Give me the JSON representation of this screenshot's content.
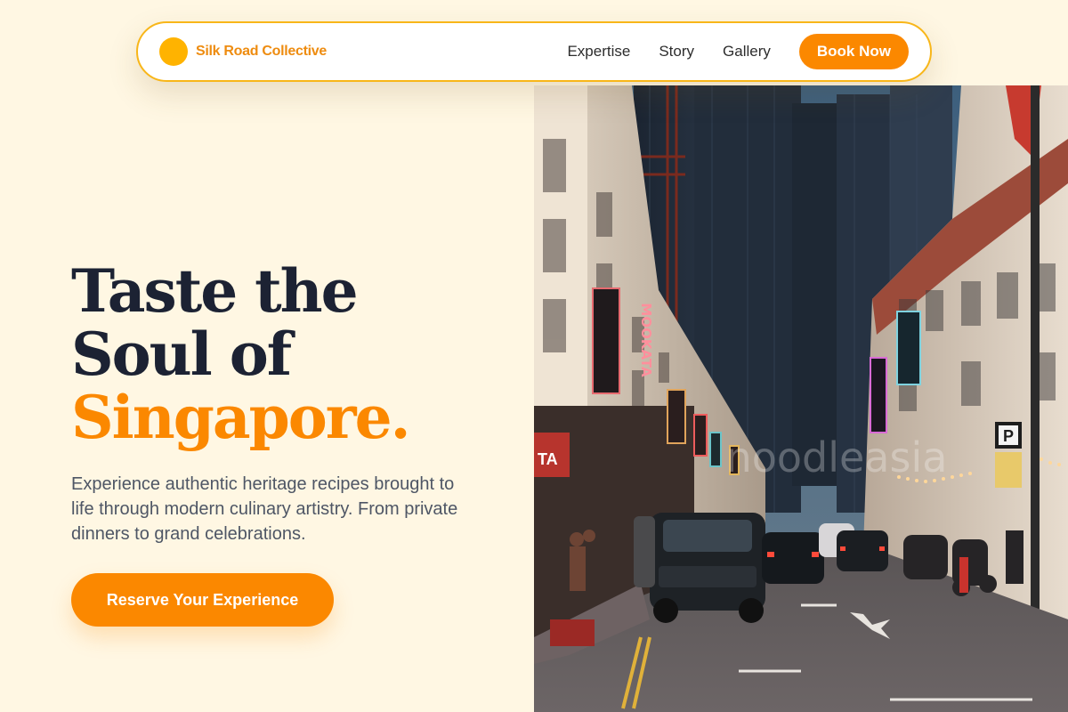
{
  "nav": {
    "brand": "Silk Road Collective",
    "links": [
      "Expertise",
      "Story",
      "Gallery"
    ],
    "cta": "Book Now"
  },
  "hero": {
    "title_line1": "Taste the",
    "title_line2": "Soul of",
    "title_accent": "Singapore.",
    "subtitle": "Experience authentic heritage recipes brought to life through modern culinary artistry. From private dinners to grand celebrations.",
    "cta": "Reserve Your Experience"
  },
  "image": {
    "alt": "Singapore street at dusk",
    "signs": [
      "MOOKATA",
      "P"
    ],
    "watermark": "noodleasia"
  },
  "colors": {
    "background": "#fff7e3",
    "accent": "#fb8800",
    "brand_dot": "#ffb300",
    "nav_border": "#f8b619",
    "heading": "#1c2233"
  }
}
